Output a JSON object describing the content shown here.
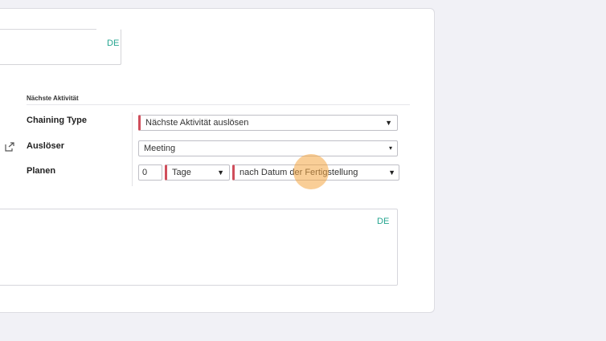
{
  "name_field": {
    "lang": "DE"
  },
  "section": {
    "title": "Nächste Aktivität"
  },
  "fields": {
    "chaining_type": {
      "label": "Chaining Type",
      "value": "Nächste Aktivität auslösen"
    },
    "trigger": {
      "label": "Auslöser",
      "value": "Meeting"
    },
    "schedule": {
      "label": "Planen",
      "amount": "0",
      "unit": "Tage",
      "reference": "nach Datum der Fertigstellung"
    }
  },
  "note_field": {
    "lang": "DE"
  },
  "icons": {
    "external_link": "external-link-icon",
    "dropdown": "chevron-down-icon"
  },
  "colors": {
    "required_marker": "#d04e5b",
    "lang_tag": "#25a58f",
    "cursor_highlight": "#f4a642"
  }
}
